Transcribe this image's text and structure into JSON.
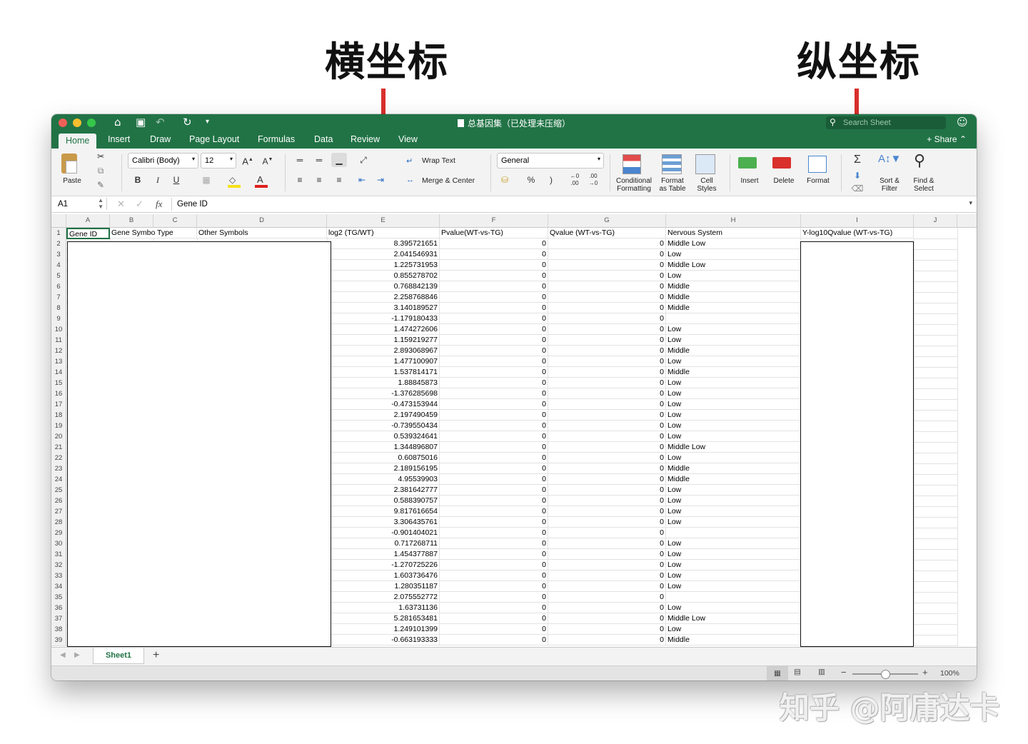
{
  "annotations": {
    "x_axis_label": "横坐标",
    "y_axis_label": "纵坐标",
    "arrow_color": "#d9302c"
  },
  "watermark": "知乎 @阿庸达卡",
  "window": {
    "title": "总基因集（已处理未压缩）",
    "search_placeholder": "Search Sheet",
    "accent_color": "#217346"
  },
  "tabs": [
    "Home",
    "Insert",
    "Draw",
    "Page Layout",
    "Formulas",
    "Data",
    "Review",
    "View"
  ],
  "share_label": "Share",
  "ribbon": {
    "paste": "Paste",
    "font_name": "Calibri (Body)",
    "font_size": "12",
    "bold": "B",
    "italic": "I",
    "underline": "U",
    "wrap_text": "Wrap Text",
    "merge_center": "Merge & Center",
    "number_format": "General",
    "percent": "%",
    "comma": ")",
    "conditional_formatting": [
      "Conditional",
      "Formatting"
    ],
    "format_as_table": [
      "Format",
      "as Table"
    ],
    "cell_styles": [
      "Cell",
      "Styles"
    ],
    "insert": "Insert",
    "delete": "Delete",
    "format": "Format",
    "sort_filter": [
      "Sort &",
      "Filter"
    ],
    "find_select": [
      "Find &",
      "Select"
    ]
  },
  "formula_bar": {
    "cell_ref": "A1",
    "fx": "fx",
    "content": "Gene ID"
  },
  "columns": [
    "A",
    "B",
    "C",
    "D",
    "E",
    "F",
    "G",
    "H",
    "I",
    "J"
  ],
  "headers": {
    "A": "Gene ID",
    "B": "Gene Symbo Type",
    "D": "Other Symbols",
    "E": "log2 (TG/WT)",
    "F": "Pvalue(WT-vs-TG)",
    "G": "Qvalue (WT-vs-TG)",
    "H": "Nervous System",
    "I": "Y-log10Qvalue (WT-vs-TG)"
  },
  "rows": [
    {
      "n": "2",
      "e": "8.395721651",
      "f": "0",
      "g": "0",
      "h": "Middle Low"
    },
    {
      "n": "3",
      "e": "2.041546931",
      "f": "0",
      "g": "0",
      "h": "Low"
    },
    {
      "n": "4",
      "e": "1.225731953",
      "f": "0",
      "g": "0",
      "h": "Middle Low"
    },
    {
      "n": "5",
      "e": "0.855278702",
      "f": "0",
      "g": "0",
      "h": "Low"
    },
    {
      "n": "6",
      "e": "0.768842139",
      "f": "0",
      "g": "0",
      "h": "Middle"
    },
    {
      "n": "7",
      "e": "2.258768846",
      "f": "0",
      "g": "0",
      "h": "Middle"
    },
    {
      "n": "8",
      "e": "3.140189527",
      "f": "0",
      "g": "0",
      "h": "Middle"
    },
    {
      "n": "9",
      "e": "-1.179180433",
      "f": "0",
      "g": "0",
      "h": ""
    },
    {
      "n": "10",
      "e": "1.474272606",
      "f": "0",
      "g": "0",
      "h": "Low"
    },
    {
      "n": "11",
      "e": "1.159219277",
      "f": "0",
      "g": "0",
      "h": "Low"
    },
    {
      "n": "12",
      "e": "2.893068967",
      "f": "0",
      "g": "0",
      "h": "Middle"
    },
    {
      "n": "13",
      "e": "1.477100907",
      "f": "0",
      "g": "0",
      "h": "Low"
    },
    {
      "n": "14",
      "e": "1.537814171",
      "f": "0",
      "g": "0",
      "h": "Middle"
    },
    {
      "n": "15",
      "e": "1.88845873",
      "f": "0",
      "g": "0",
      "h": "Low"
    },
    {
      "n": "16",
      "e": "-1.376285698",
      "f": "0",
      "g": "0",
      "h": "Low"
    },
    {
      "n": "17",
      "e": "-0.473153944",
      "f": "0",
      "g": "0",
      "h": "Low"
    },
    {
      "n": "18",
      "e": "2.197490459",
      "f": "0",
      "g": "0",
      "h": "Low"
    },
    {
      "n": "19",
      "e": "-0.739550434",
      "f": "0",
      "g": "0",
      "h": "Low"
    },
    {
      "n": "20",
      "e": "0.539324641",
      "f": "0",
      "g": "0",
      "h": "Low"
    },
    {
      "n": "21",
      "e": "1.344896807",
      "f": "0",
      "g": "0",
      "h": "Middle Low"
    },
    {
      "n": "22",
      "e": "0.60875016",
      "f": "0",
      "g": "0",
      "h": "Low"
    },
    {
      "n": "23",
      "e": "2.189156195",
      "f": "0",
      "g": "0",
      "h": "Middle"
    },
    {
      "n": "24",
      "e": "4.95539903",
      "f": "0",
      "g": "0",
      "h": "Middle"
    },
    {
      "n": "25",
      "e": "2.381642777",
      "f": "0",
      "g": "0",
      "h": "Low"
    },
    {
      "n": "26",
      "e": "0.588390757",
      "f": "0",
      "g": "0",
      "h": "Low"
    },
    {
      "n": "27",
      "e": "9.817616654",
      "f": "0",
      "g": "0",
      "h": "Low"
    },
    {
      "n": "28",
      "e": "3.306435761",
      "f": "0",
      "g": "0",
      "h": "Low"
    },
    {
      "n": "29",
      "e": "-0.901404021",
      "f": "0",
      "g": "0",
      "h": ""
    },
    {
      "n": "30",
      "e": "0.717268711",
      "f": "0",
      "g": "0",
      "h": "Low"
    },
    {
      "n": "31",
      "e": "1.454377887",
      "f": "0",
      "g": "0",
      "h": "Low"
    },
    {
      "n": "32",
      "e": "-1.270725226",
      "f": "0",
      "g": "0",
      "h": "Low"
    },
    {
      "n": "33",
      "e": "1.603736476",
      "f": "0",
      "g": "0",
      "h": "Low"
    },
    {
      "n": "34",
      "e": "1.280351187",
      "f": "0",
      "g": "0",
      "h": "Low"
    },
    {
      "n": "35",
      "e": "2.075552772",
      "f": "0",
      "g": "0",
      "h": ""
    },
    {
      "n": "36",
      "e": "1.63731136",
      "f": "0",
      "g": "0",
      "h": "Low"
    },
    {
      "n": "37",
      "e": "5.281653481",
      "f": "0",
      "g": "0",
      "h": "Middle Low"
    },
    {
      "n": "38",
      "e": "1.249101399",
      "f": "0",
      "g": "0",
      "h": "Low"
    },
    {
      "n": "39",
      "e": "-0.663193333",
      "f": "0",
      "g": "0",
      "h": "Middle"
    }
  ],
  "sheet_tab": "Sheet1",
  "add_sheet": "+",
  "zoom": "100%"
}
